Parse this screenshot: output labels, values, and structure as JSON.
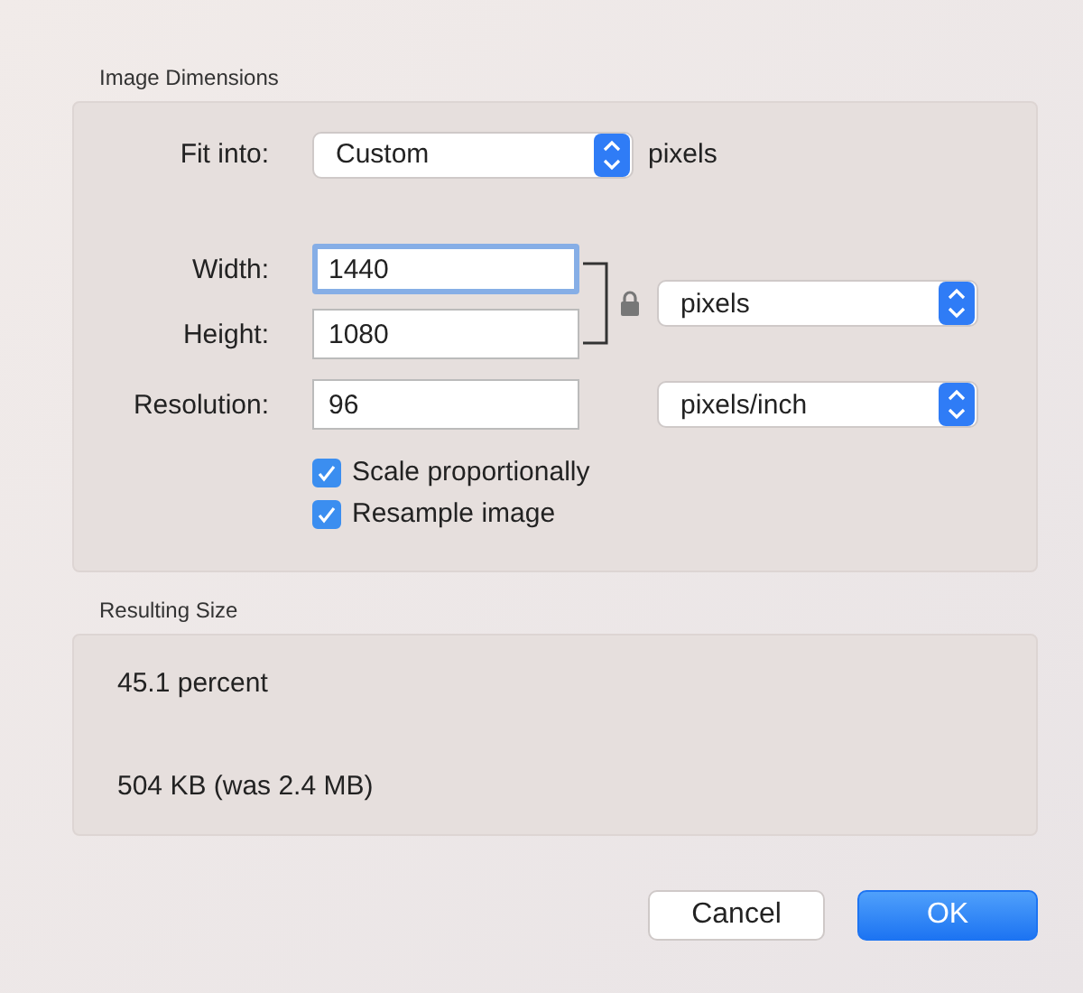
{
  "image_dimensions": {
    "title": "Image Dimensions",
    "fit_into": {
      "label": "Fit into:",
      "value": "Custom",
      "unit": "pixels"
    },
    "width": {
      "label": "Width:",
      "value": "1440",
      "focused": true
    },
    "height": {
      "label": "Height:",
      "value": "1080",
      "focused": false
    },
    "size_unit": {
      "value": "pixels"
    },
    "proportions_locked": true,
    "resolution": {
      "label": "Resolution:",
      "value": "96",
      "unit": "pixels/inch"
    },
    "options": [
      {
        "label": "Scale proportionally",
        "checked": true
      },
      {
        "label": "Resample image",
        "checked": true
      }
    ]
  },
  "resulting_size": {
    "title": "Resulting Size",
    "lines": [
      "45.1 percent",
      "504 KB (was 2.4 MB)"
    ]
  },
  "buttons": [
    {
      "label": "Cancel",
      "default": false
    },
    {
      "label": "OK",
      "default": true
    }
  ]
}
